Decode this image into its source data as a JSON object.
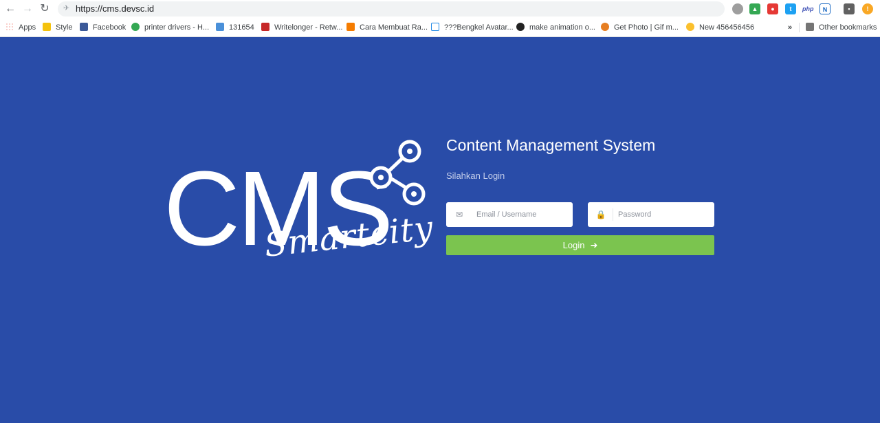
{
  "browser": {
    "url": "https://cms.devsc.id",
    "bookmarks": [
      {
        "label": "Apps",
        "icon": "apps-grid-icon",
        "color": "#ea4335"
      },
      {
        "label": "Style",
        "icon": "style-icon",
        "color": "#f4c20d"
      },
      {
        "label": "Facebook",
        "icon": "facebook-icon",
        "color": "#3b5998"
      },
      {
        "label": "printer drivers - H...",
        "icon": "heart-icon",
        "color": "#34a853"
      },
      {
        "label": "131654",
        "icon": "image-icon",
        "color": "#4a90d9"
      },
      {
        "label": "Writelonger - Retw...",
        "icon": "w-icon",
        "color": "#c62828"
      },
      {
        "label": "Cara Membuat Ra...",
        "icon": "blogger-icon",
        "color": "#f57c00"
      },
      {
        "label": "???Bengkel Avatar...",
        "icon": "k-icon",
        "color": "#1e88e5"
      },
      {
        "label": "make animation o...",
        "icon": "animation-icon",
        "color": "#222222"
      },
      {
        "label": "Get Photo | Gif m...",
        "icon": "photo-icon",
        "color": "#e67e22"
      },
      {
        "label": "New 456456456",
        "icon": "medal-icon",
        "color": "#fbc02d"
      }
    ],
    "more": "»",
    "other_bookmarks": "Other bookmarks"
  },
  "logo": {
    "main": "CMS",
    "script": "Smartcity"
  },
  "login": {
    "title": "Content Management System",
    "subtitle": "Silahkan Login",
    "email_placeholder": "Email / Username",
    "password_placeholder": "Password",
    "button_label": "Login",
    "button_arrow": "➜"
  },
  "colors": {
    "background": "#294ca8",
    "button": "#7bc44f"
  }
}
